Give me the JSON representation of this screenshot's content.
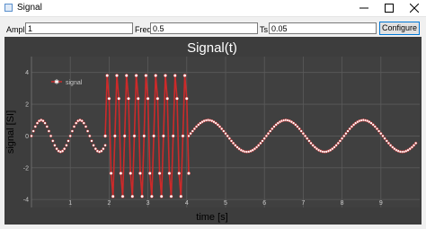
{
  "window": {
    "title": "Signal"
  },
  "toolbar": {
    "ampl_label": "Ampl",
    "ampl_value": "1",
    "freq_label": "Freq",
    "freq_value": "0.5",
    "ts_label": "Ts",
    "ts_value": "0.05",
    "configure_label": "Configure"
  },
  "colors": {
    "plot_bg": "#404040",
    "grid": "#5a5a5a",
    "marker": "#ffffff",
    "line": "#cc2a2a"
  },
  "chart_data": {
    "type": "line",
    "title": "Signal(t)",
    "xlabel": "time [s]",
    "ylabel": "signal [SI]",
    "xlim": [
      0,
      10
    ],
    "ylim": [
      -4.5,
      5
    ],
    "xticks": [
      "1",
      "2",
      "3",
      "4",
      "5",
      "6",
      "7",
      "8",
      "9"
    ],
    "yticks": [
      "4",
      "2",
      "0",
      "-2",
      "-4"
    ],
    "grid": true,
    "legend": "top-left",
    "series": [
      {
        "name": "signal",
        "segments": [
          {
            "t_start": 0,
            "t_end": 1.9,
            "amplitude": 1,
            "frequency": 1,
            "style": "markers"
          },
          {
            "t_start": 1.9,
            "t_end": 4.05,
            "amplitude": 4,
            "frequency": 4,
            "style": "markers+line"
          },
          {
            "t_start": 4.05,
            "t_end": 9.9,
            "amplitude": 1,
            "frequency": 0.5,
            "style": "markers"
          }
        ]
      }
    ]
  }
}
